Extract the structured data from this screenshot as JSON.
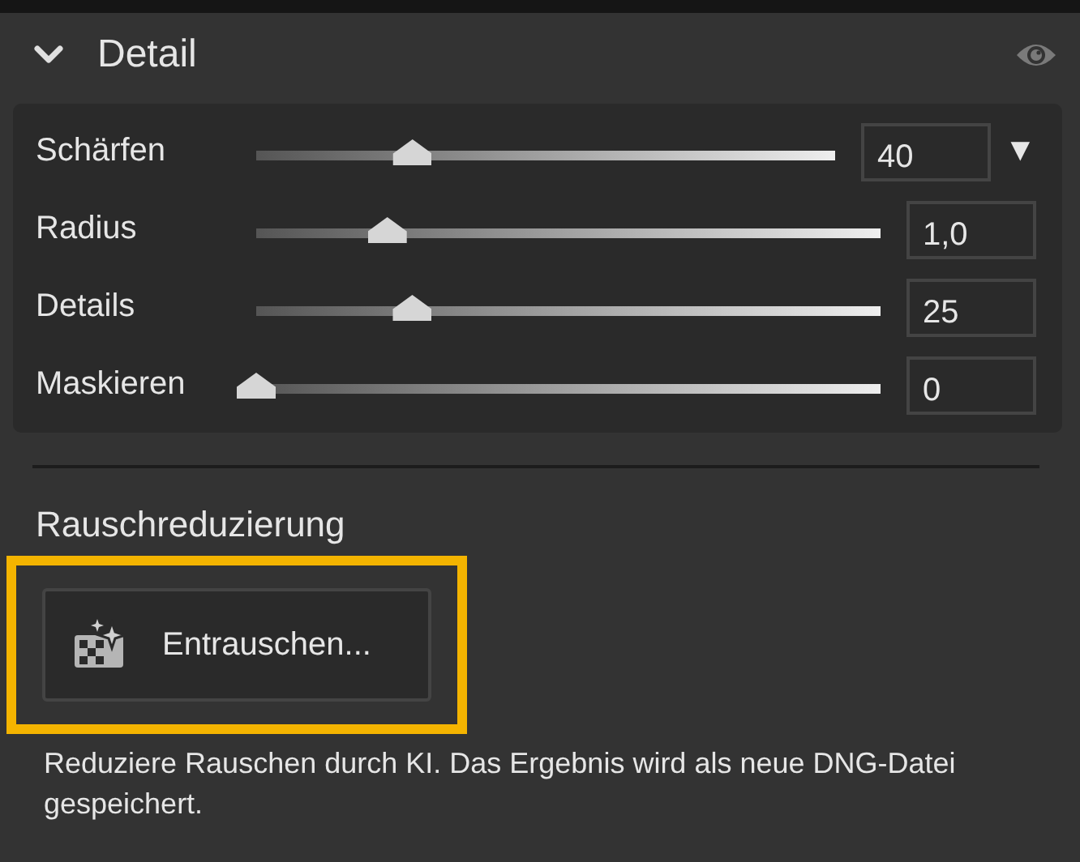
{
  "panel": {
    "title": "Detail",
    "expanded": true
  },
  "sliders": [
    {
      "label": "Schärfen",
      "level": 0.27,
      "value": "40",
      "menu": "▼"
    },
    {
      "label": "Radius",
      "level": 0.21,
      "value": "1,0"
    },
    {
      "label": "Details",
      "level": 0.25,
      "value": "25"
    },
    {
      "label": "Maskieren",
      "level": 0,
      "value": "0"
    }
  ],
  "noise_reduction": {
    "heading": "Rauschreduzierung",
    "button": {
      "label": "Entrauschen...",
      "highlighted": true
    },
    "description": "Reduziere Rauschen durch KI. Das Ergebnis wird als neue DNG-Datei gespeichert."
  }
}
